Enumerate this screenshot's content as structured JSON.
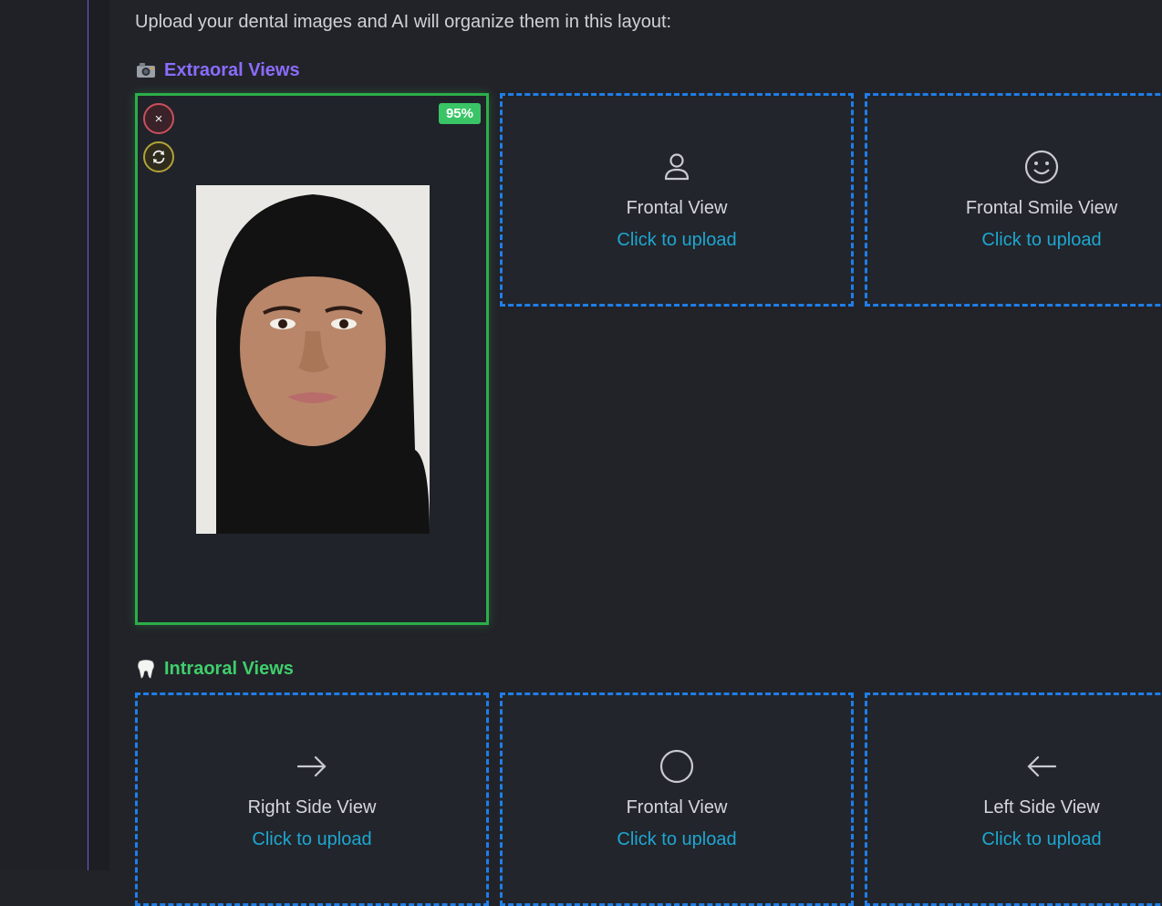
{
  "intro_text": "Upload your dental images and AI will organize them in this layout:",
  "extraoral": {
    "title": "Extraoral Views",
    "icon": "camera-icon",
    "filled_card": {
      "confidence": "95%",
      "remove_label": "×"
    },
    "slots": [
      {
        "label": "Frontal View",
        "cta": "Click to upload",
        "icon": "person-icon"
      },
      {
        "label": "Frontal Smile View",
        "cta": "Click to upload",
        "icon": "smile-icon"
      }
    ]
  },
  "intraoral": {
    "title": "Intraoral Views",
    "icon": "tooth-icon",
    "slots": [
      {
        "label": "Right Side View",
        "cta": "Click to upload",
        "icon": "arrow-right-icon"
      },
      {
        "label": "Frontal View",
        "cta": "Click to upload",
        "icon": "circle-icon"
      },
      {
        "label": "Left Side View",
        "cta": "Click to upload",
        "icon": "arrow-left-icon"
      }
    ]
  },
  "colors": {
    "background": "#222329",
    "extraoral_title": "#8b6cff",
    "intraoral_title": "#3fcf6b",
    "upload_border": "#1f7ee8",
    "filled_border": "#2dae4a",
    "link": "#1ea6d1"
  }
}
